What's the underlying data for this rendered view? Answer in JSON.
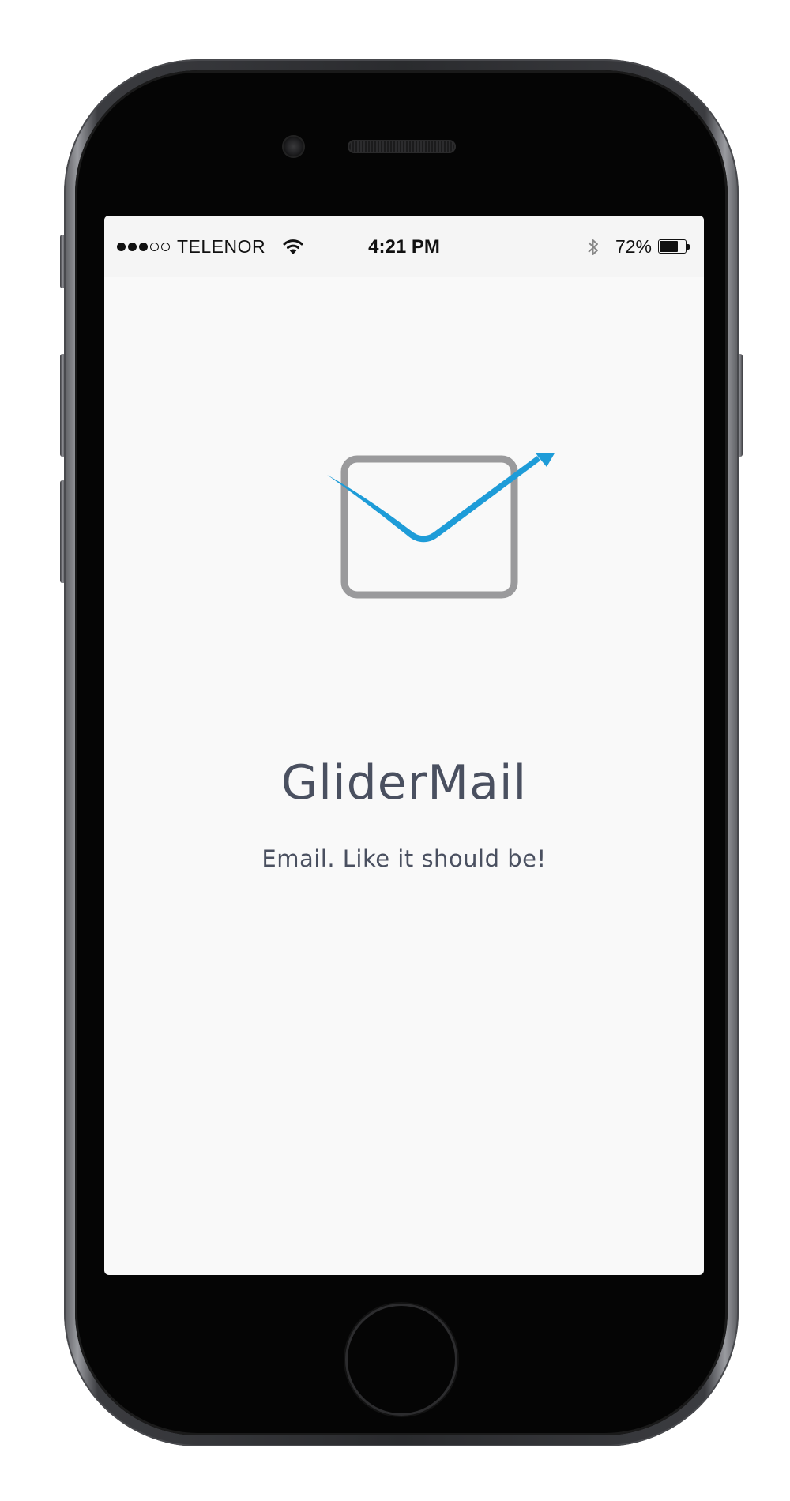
{
  "status_bar": {
    "signal_dots": [
      true,
      true,
      true,
      false,
      false
    ],
    "carrier": "TELENOR",
    "wifi_icon": "wifi-icon",
    "time": "4:21 PM",
    "bluetooth_icon": "bluetooth-icon",
    "battery_percent": "72%",
    "battery_level": 0.72
  },
  "splash": {
    "logo_icon": "envelope-with-glider-arrow-icon",
    "title": "GliderMail",
    "tagline": "Email. Like it should be!"
  },
  "colors": {
    "accent": "#1e9cd8",
    "envelope": "#9a9a9c",
    "text": "#4a5060",
    "screen_background": "#f9f9f9"
  }
}
